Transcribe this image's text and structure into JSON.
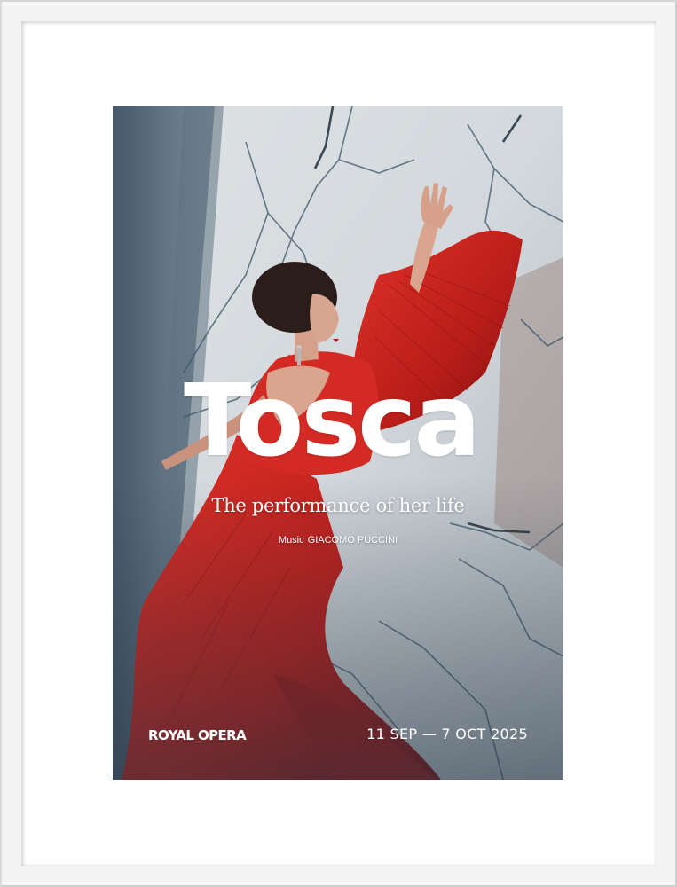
{
  "poster": {
    "title": "Tosca",
    "tagline": "The performance of her life",
    "credit_label": "Music",
    "composer": "GIACOMO PUCCINI",
    "company": "ROYAL OPERA",
    "dates": "11 SEP — 7 OCT 2025"
  },
  "colors": {
    "dress": "#c8241f",
    "wall": "#d9dde0",
    "frame": "#ffffff"
  }
}
